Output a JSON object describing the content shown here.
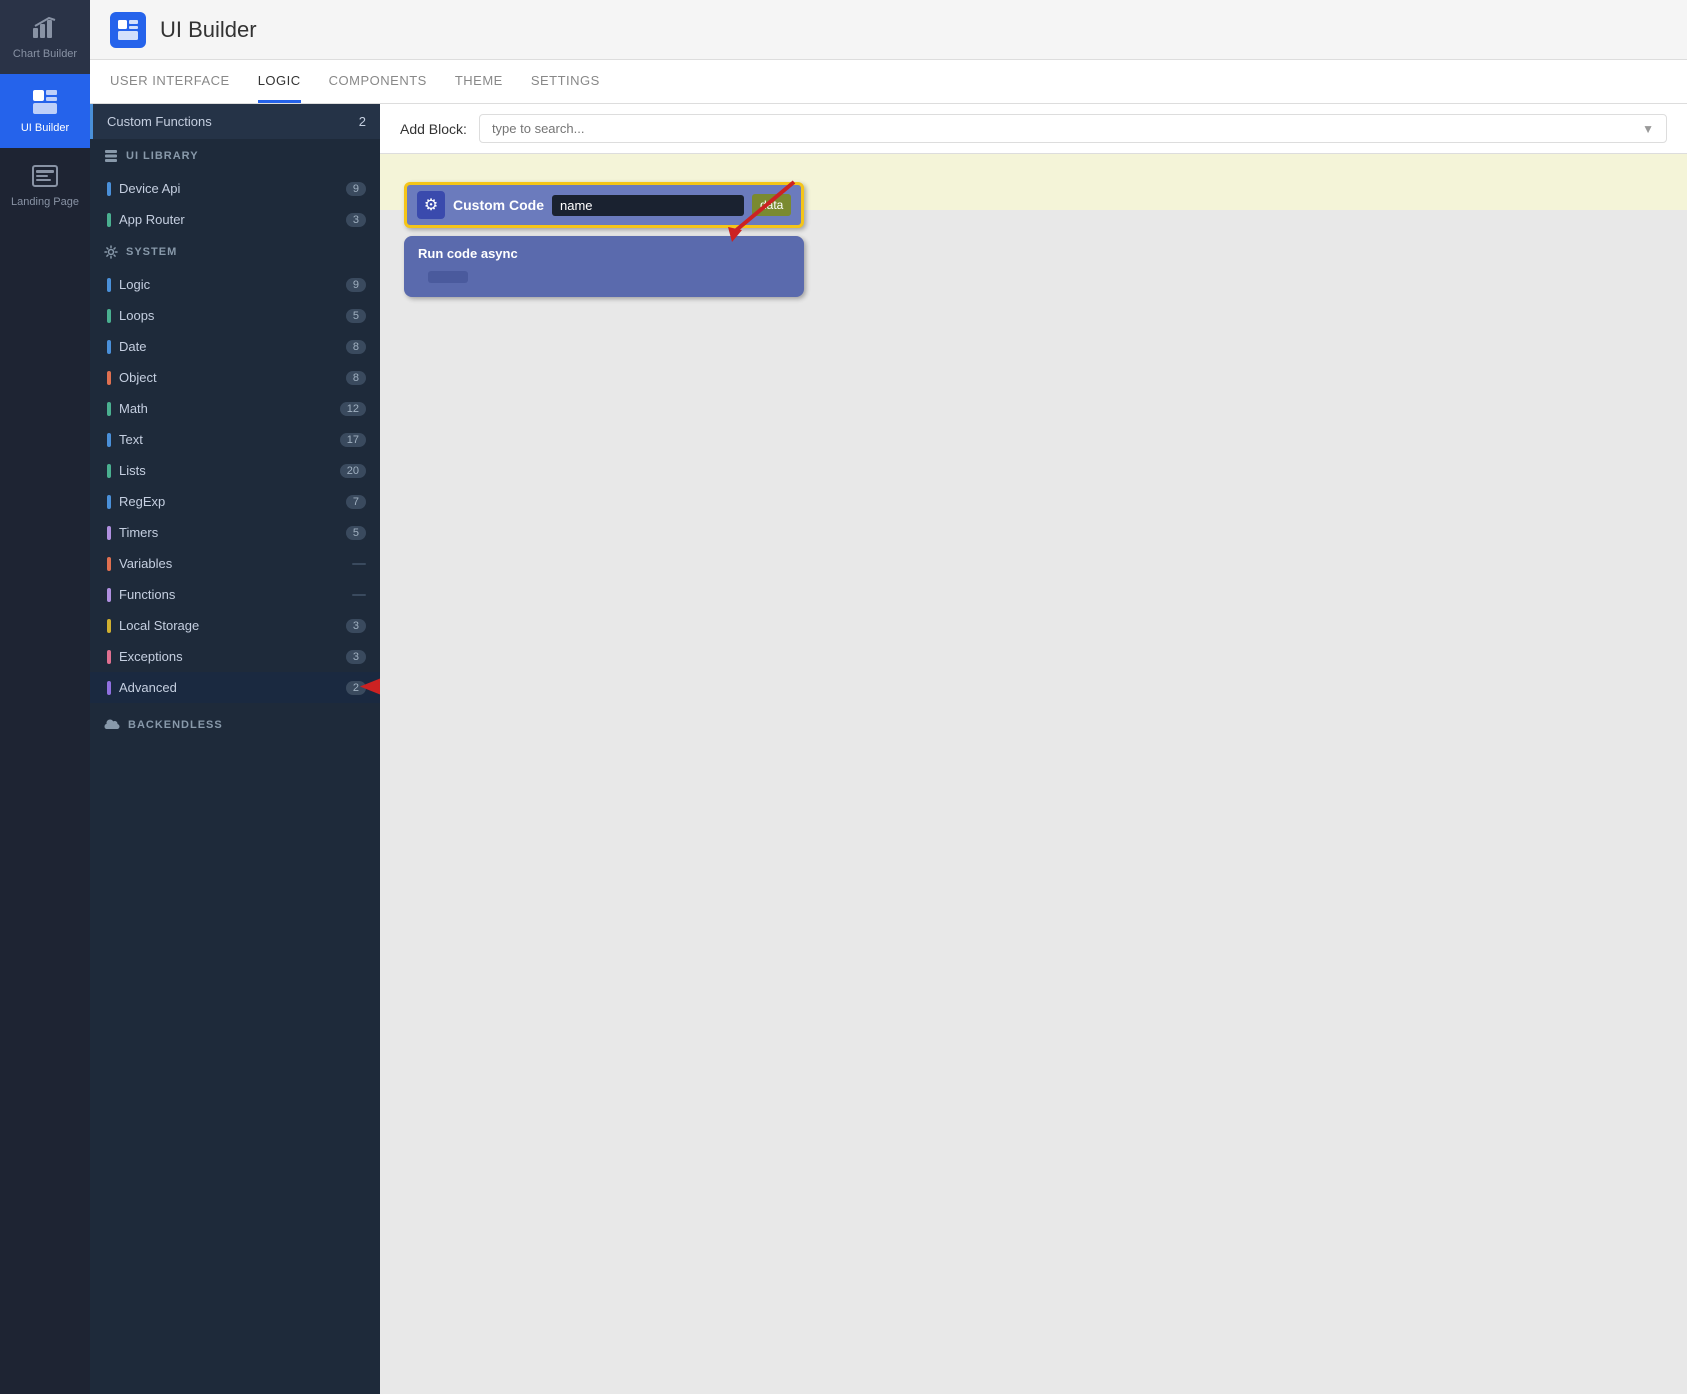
{
  "app": {
    "title": "UI Builder"
  },
  "iconSidebar": {
    "items": [
      {
        "id": "chart-builder",
        "label": "Chart Builder",
        "active": false
      },
      {
        "id": "ui-builder",
        "label": "UI Builder",
        "active": true
      },
      {
        "id": "landing-page",
        "label": "Landing Page",
        "active": false
      }
    ]
  },
  "navTabs": {
    "items": [
      {
        "id": "user-interface",
        "label": "USER INTERFACE",
        "active": false
      },
      {
        "id": "logic",
        "label": "LOGIC",
        "active": true
      },
      {
        "id": "components",
        "label": "COMPONENTS",
        "active": false
      },
      {
        "id": "theme",
        "label": "THEME",
        "active": false
      },
      {
        "id": "settings",
        "label": "SETTINGS",
        "active": false
      }
    ]
  },
  "leftPanel": {
    "customFunctions": {
      "label": "Custom Functions",
      "badge": "2"
    },
    "uiLibrary": {
      "sectionLabel": "UI LIBRARY",
      "items": [
        {
          "id": "device-api",
          "label": "Device Api",
          "badge": "9",
          "color": "#4a90d9"
        },
        {
          "id": "app-router",
          "label": "App Router",
          "badge": "3",
          "color": "#4ab090"
        }
      ]
    },
    "system": {
      "sectionLabel": "SYSTEM",
      "items": [
        {
          "id": "logic",
          "label": "Logic",
          "badge": "9",
          "color": "#4a90d9"
        },
        {
          "id": "loops",
          "label": "Loops",
          "badge": "5",
          "color": "#4ab090"
        },
        {
          "id": "date",
          "label": "Date",
          "badge": "8",
          "color": "#4a90d9"
        },
        {
          "id": "object",
          "label": "Object",
          "badge": "8",
          "color": "#e07050"
        },
        {
          "id": "math",
          "label": "Math",
          "badge": "12",
          "color": "#4ab090"
        },
        {
          "id": "text",
          "label": "Text",
          "badge": "17",
          "color": "#4a90d9"
        },
        {
          "id": "lists",
          "label": "Lists",
          "badge": "20",
          "color": "#4ab090"
        },
        {
          "id": "regexp",
          "label": "RegExp",
          "badge": "7",
          "color": "#4a90d9"
        },
        {
          "id": "timers",
          "label": "Timers",
          "badge": "5",
          "color": "#b090e0"
        },
        {
          "id": "variables",
          "label": "Variables",
          "badge": "",
          "color": "#e07050"
        },
        {
          "id": "functions",
          "label": "Functions",
          "badge": "",
          "color": "#b090e0"
        },
        {
          "id": "local-storage",
          "label": "Local Storage",
          "badge": "3",
          "color": "#d0b030"
        },
        {
          "id": "exceptions",
          "label": "Exceptions",
          "badge": "3",
          "color": "#e07090"
        },
        {
          "id": "advanced",
          "label": "Advanced",
          "badge": "2",
          "color": "#9070e0",
          "highlighted": true
        }
      ]
    },
    "backendless": {
      "sectionLabel": "BACKENDLESS"
    }
  },
  "addBlock": {
    "label": "Add Block:",
    "placeholder": "type to search..."
  },
  "canvas": {
    "customCodeBlock": {
      "gearIcon": "⚙",
      "label": "Custom Code",
      "nameField": "name",
      "dataTab": "data"
    },
    "runCodeBlock": {
      "label": "Run code async"
    }
  }
}
